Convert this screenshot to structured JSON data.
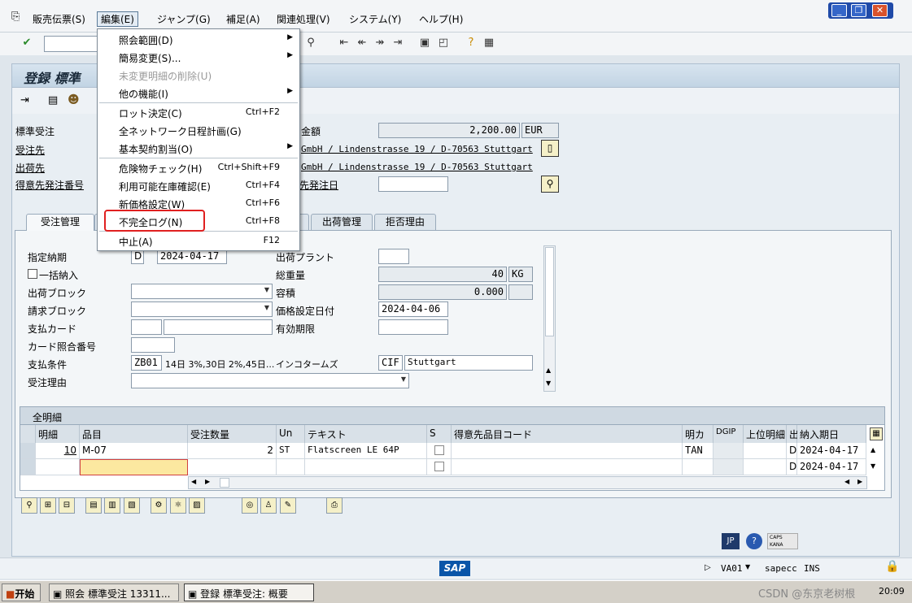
{
  "menubar": {
    "items": [
      "販売伝票(S)",
      "編集(E)",
      "ジャンプ(G)",
      "補足(A)",
      "関連処理(V)",
      "システム(Y)",
      "ヘルプ(H)"
    ]
  },
  "window_controls": {
    "minimize": "_",
    "restore": "❐",
    "close": "✕"
  },
  "title": {
    "text": "登録 標準"
  },
  "edit_menu": {
    "items": [
      {
        "label": "照会範囲(D)",
        "shortcut": "",
        "arrow": "▶"
      },
      {
        "label": "簡易変更(S)...",
        "shortcut": "",
        "arrow": "▶"
      },
      {
        "label": "未変更明細の削除(U)",
        "shortcut": "",
        "arrow": ""
      },
      {
        "label": "他の機能(I)",
        "shortcut": "",
        "arrow": "▶"
      },
      {
        "label": "ロット決定(C)",
        "shortcut": "Ctrl+F2",
        "arrow": ""
      },
      {
        "label": "全ネットワーク日程計画(G)",
        "shortcut": "",
        "arrow": ""
      },
      {
        "label": "基本契約割当(O)",
        "shortcut": "",
        "arrow": "▶"
      },
      {
        "label": "危険物チェック(H)",
        "shortcut": "Ctrl+Shift+F9",
        "arrow": ""
      },
      {
        "label": "利用可能在庫確認(E)",
        "shortcut": "Ctrl+F4",
        "arrow": ""
      },
      {
        "label": "新価格設定(W)",
        "shortcut": "Ctrl+F6",
        "arrow": ""
      },
      {
        "label": "不完全ログ(N)",
        "shortcut": "Ctrl+F8",
        "arrow": ""
      },
      {
        "label": "中止(A)",
        "shortcut": "F12",
        "arrow": ""
      }
    ]
  },
  "header": {
    "order_type_label": "標準受注",
    "sold_to_label": "受注先",
    "ship_to_label": "出荷先",
    "cust_po_label": "得意先発注番号",
    "net_value_label": "金額",
    "net_value": "2,200.00",
    "currency": "EUR",
    "sold_to_addr": "GmbH / Lindenstrasse 19 / D-70563 Stuttgart",
    "ship_to_addr": "GmbH / Lindenstrasse 19 / D-70563 Stuttgart",
    "po_date_label": "先発注日"
  },
  "tabs": [
    {
      "label": "受注管理"
    },
    {
      "label": "出荷管理"
    },
    {
      "label": "拒否理由"
    }
  ],
  "sales_tab": {
    "req_date_label": "指定納期",
    "req_date_type": "D",
    "req_date": "2024-04-17",
    "complete_delivery_label": "一括納入",
    "delivery_block_label": "出荷ブロック",
    "billing_block_label": "請求ブロック",
    "payment_card_label": "支払カード",
    "card_verif_label": "カード照合番号",
    "payment_terms_label": "支払条件",
    "payment_terms": "ZB01",
    "payment_terms_text": "14日 3%,30日 2%,45日...",
    "order_reason_label": "受注理由",
    "plant_label": "出荷プラント",
    "total_weight_label": "総重量",
    "total_weight": "40",
    "weight_unit": "KG",
    "volume_label": "容積",
    "volume": "0.000",
    "pricing_date_label": "価格設定日付",
    "pricing_date": "2024-04-06",
    "valid_to_label": "有効期限",
    "incoterms_label": "インコタームズ",
    "incoterms": "CIF",
    "incoterms_place": "Stuttgart"
  },
  "items": {
    "caption": "全明細",
    "columns": [
      "明細",
      "品目",
      "受注数量",
      "Un",
      "テキスト",
      "S",
      "得意先品目コード",
      "明カ",
      "DGIP",
      "上位明細",
      "出",
      "納入期日"
    ],
    "rows": [
      {
        "item": "10",
        "material": "M-07",
        "qty": "2",
        "unit": "ST",
        "text": "Flatscreen LE 64P",
        "cat": "TAN",
        "ind": "D",
        "date": "2024-04-17"
      },
      {
        "item": "",
        "material": "",
        "qty": "",
        "unit": "",
        "text": "",
        "cat": "",
        "ind": "D",
        "date": "2024-04-17"
      }
    ]
  },
  "status": {
    "transaction": "VA01",
    "system": "sapecc",
    "mode": "INS",
    "lang": "JP",
    "caps": "CAPS",
    "kana": "KANA"
  },
  "taskbar": {
    "start": "开始",
    "task1": "照会 標準受注 13311...",
    "task2": "登録 標準受注: 概要",
    "clock": "20:09",
    "watermark": "CSDN @东京老树根"
  },
  "brand_color": "#0a55a8"
}
